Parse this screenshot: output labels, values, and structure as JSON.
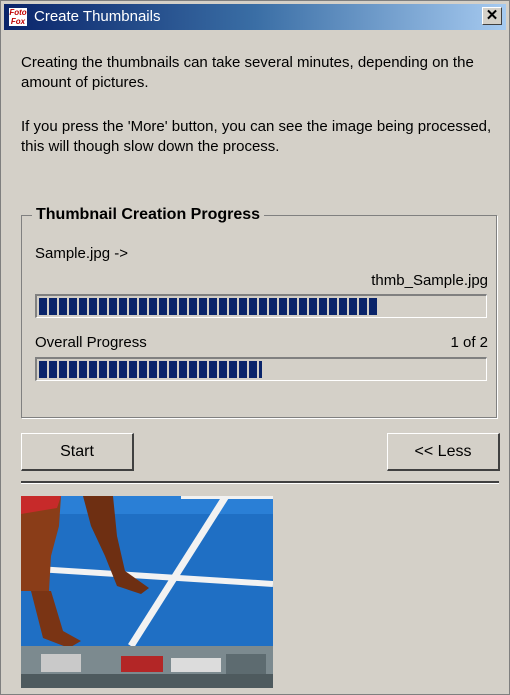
{
  "window": {
    "title": "Create Thumbnails",
    "icon": "app-logo-icon",
    "icon_text": "Foto Fox",
    "close_glyph": "✕"
  },
  "info": {
    "paragraph1": "Creating the thumbnails can take several minutes, depending on the amount of pictures.",
    "paragraph2": "If you press the 'More' button, you can see the image being processed, this will though slow down the process."
  },
  "progress_group": {
    "title": "Thumbnail Creation Progress",
    "source_file": "Sample.jpg ->",
    "target_file": "thmb_Sample.jpg",
    "file_progress_fraction": 0.76,
    "overall_label": "Overall Progress",
    "overall_count": "1 of 2",
    "overall_progress_fraction": 0.5
  },
  "buttons": {
    "start_label": "Start",
    "less_label": "<< Less"
  },
  "preview": {
    "description_icon": "image-preview"
  },
  "colors": {
    "progress_fill": "#0a246a",
    "titlebar_start": "#0a246a",
    "titlebar_end": "#a6caf0"
  }
}
